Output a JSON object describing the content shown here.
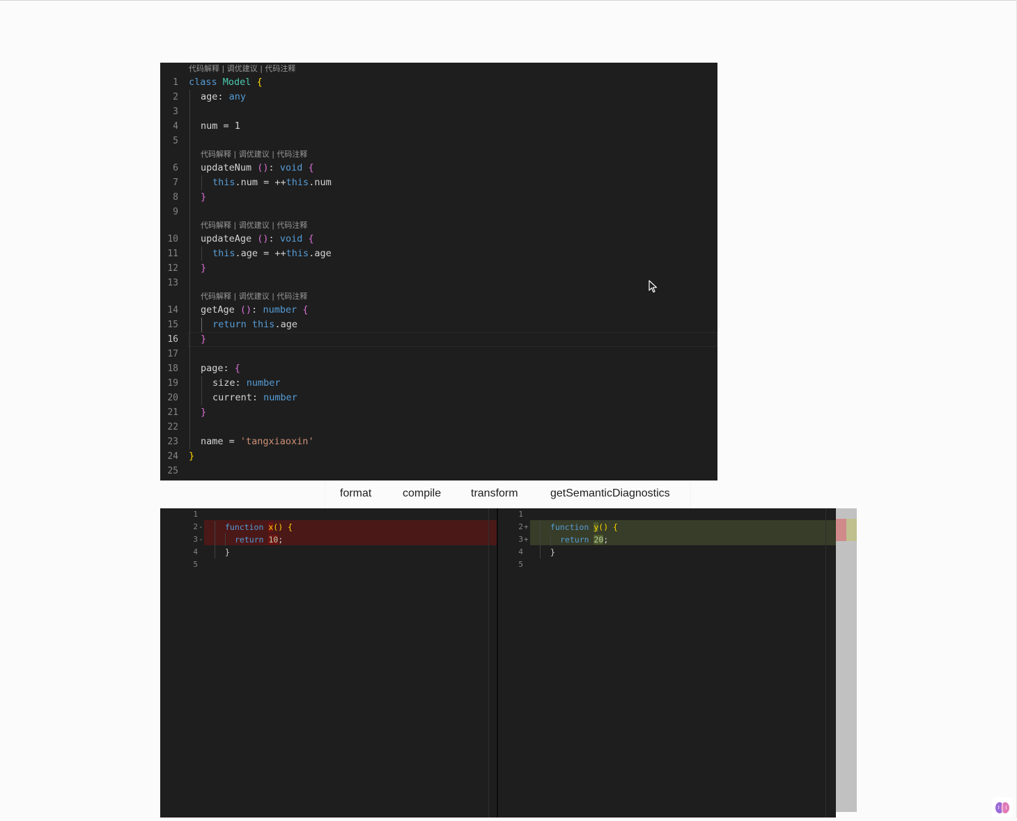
{
  "editor": {
    "codelens": {
      "explain": "代码解释",
      "sep": " | ",
      "optimize": "调优建议",
      "comment": "代码注释",
      "full": "代码解释 | 调优建议 | 代码注释"
    },
    "lines": {
      "n": [
        "1",
        "2",
        "3",
        "4",
        "5",
        "6",
        "7",
        "8",
        "9",
        "10",
        "11",
        "12",
        "13",
        "14",
        "15",
        "16",
        "17",
        "18",
        "19",
        "20",
        "21",
        "22",
        "23",
        "24",
        "25"
      ],
      "l1": {
        "kw": "class",
        "cls": "Model",
        "br": "{"
      },
      "l2": {
        "prop": "age: ",
        "ty": "any"
      },
      "l4": {
        "text": "num = 1"
      },
      "l6": {
        "name": "updateNum ",
        "paren": "()",
        "colon": ": ",
        "ty": "void",
        "br": "{"
      },
      "l7": {
        "this1": "this",
        "mid": ".num = ++",
        "this2": "this",
        "end": ".num"
      },
      "l8": {
        "br": "}"
      },
      "l10": {
        "name": "updateAge ",
        "paren": "()",
        "colon": ": ",
        "ty": "void",
        "br": "{"
      },
      "l11": {
        "this1": "this",
        "mid": ".age = ++",
        "this2": "this",
        "end": ".age"
      },
      "l12": {
        "br": "}"
      },
      "l14": {
        "name": "getAge ",
        "paren": "()",
        "colon": ": ",
        "ty": "number",
        "br": "{"
      },
      "l15": {
        "ret": "return",
        "sp": " ",
        "this1": "this",
        "end": ".age"
      },
      "l16": {
        "br": "}"
      },
      "l18": {
        "prop": "page: ",
        "br": "{"
      },
      "l19": {
        "prop": "size: ",
        "ty": "number"
      },
      "l20": {
        "prop": "current: ",
        "ty": "number"
      },
      "l21": {
        "br": "}"
      },
      "l23": {
        "prop": "name = ",
        "str": "'tangxiaoxin'"
      },
      "l24": {
        "br": "}"
      }
    }
  },
  "toolbar": {
    "format": "format",
    "compile": "compile",
    "transform": "transform",
    "diagnostics": "getSemanticDiagnostics"
  },
  "diff": {
    "left": {
      "n": [
        "1",
        "2",
        "3",
        "4",
        "5"
      ],
      "signs": [
        "-",
        "-"
      ],
      "l2": {
        "kw": "function",
        "sp": " ",
        "name": "x",
        "rest": "() {"
      },
      "l3": {
        "kw": "return",
        "sp": " ",
        "num": "10",
        "end": ";"
      },
      "l4": "}"
    },
    "right": {
      "n": [
        "1",
        "2",
        "3",
        "4",
        "5"
      ],
      "signs": [
        "+",
        "+"
      ],
      "l2": {
        "kw": "function",
        "sp": " ",
        "name": "y",
        "rest": "() {"
      },
      "l3": {
        "kw": "return",
        "sp": " ",
        "num": "20",
        "end": ";"
      },
      "l4": "}"
    }
  },
  "colors": {
    "delete": "#4b1818",
    "insert": "#373d29",
    "keyword": "#569cd6",
    "class": "#4ec9b0",
    "string": "#ce9178",
    "bracket_gold": "#ffd700",
    "bracket_purple": "#da70d6"
  },
  "icons": {
    "cursor": "mouse-pointer-icon",
    "assistant": "brain-icon"
  }
}
